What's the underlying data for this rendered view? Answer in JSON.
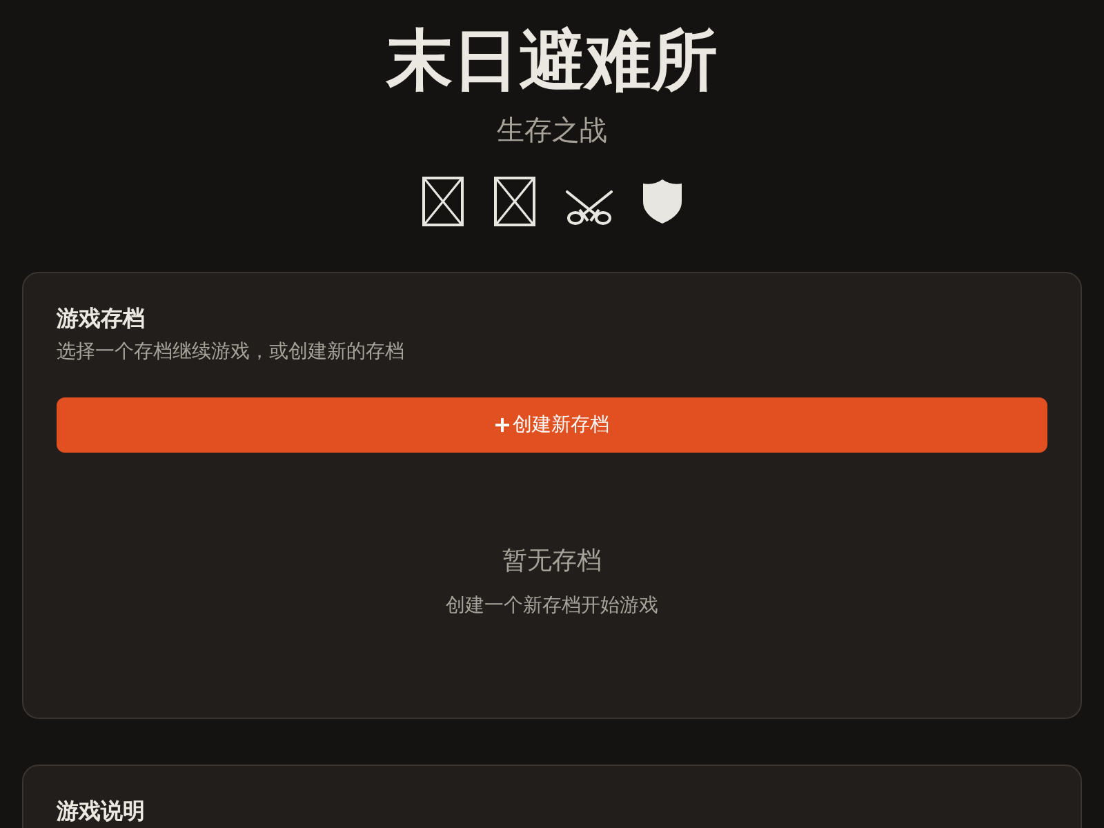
{
  "header": {
    "title": "末日避难所",
    "subtitle": "生存之战",
    "icons": [
      {
        "kind": "missing"
      },
      {
        "kind": "missing"
      },
      {
        "kind": "swords"
      },
      {
        "kind": "shield"
      }
    ]
  },
  "saves_card": {
    "title": "游戏存档",
    "description": "选择一个存档继续游戏，或创建新的存档",
    "create_button": {
      "label": "创建新存档"
    },
    "empty_state": {
      "title": "暂无存档",
      "hint": "创建一个新存档开始游戏"
    }
  },
  "guide_card": {
    "title": "游戏说明"
  }
}
